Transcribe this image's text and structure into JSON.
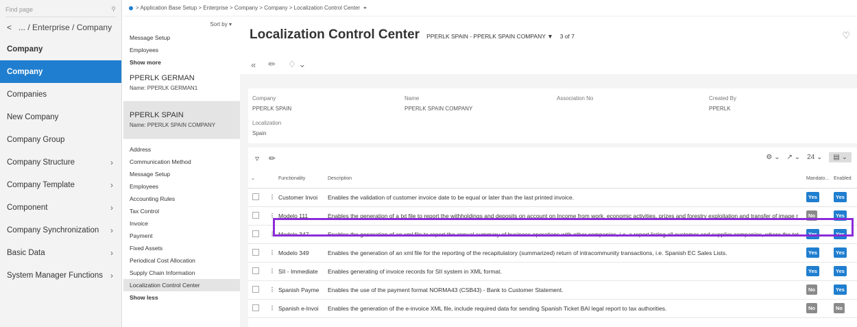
{
  "nav": {
    "search_placeholder": "Find page",
    "back_label": "... / Enterprise / Company",
    "items": [
      {
        "label": "Company",
        "style": "bold",
        "chevron": false
      },
      {
        "label": "Company",
        "style": "active",
        "chevron": false
      },
      {
        "label": "Companies",
        "style": "",
        "chevron": false
      },
      {
        "label": "New Company",
        "style": "",
        "chevron": false
      },
      {
        "label": "Company Group",
        "style": "",
        "chevron": false
      },
      {
        "label": "Company Structure",
        "style": "",
        "chevron": true
      },
      {
        "label": "Company Template",
        "style": "",
        "chevron": true
      },
      {
        "label": "Component",
        "style": "",
        "chevron": true
      },
      {
        "label": "Company Synchronization",
        "style": "",
        "chevron": true
      },
      {
        "label": "Basic Data",
        "style": "",
        "chevron": true
      },
      {
        "label": "System Manager Functions",
        "style": "",
        "chevron": true
      }
    ]
  },
  "breadcrumb": "> Application Base Setup > Enterprise > Company > Company > Localization Control Center",
  "middle": {
    "sort_label": "Sort by",
    "top_links": [
      "Message Setup",
      "Employees"
    ],
    "show_more": "Show more",
    "cards": [
      {
        "title": "PPERLK GERMAN",
        "name": "Name:  PPERLK GERMAN1"
      },
      {
        "title": "PPERLK SPAIN",
        "name": "Name:  PPERLK SPAIN COMPANY"
      }
    ],
    "links": [
      "Address",
      "Communication Method",
      "Message Setup",
      "Employees",
      "Accounting Rules",
      "Tax Control",
      "Invoice",
      "Payment",
      "Fixed Assets",
      "Periodical Cost Allocation",
      "Supply Chain Information",
      "Localization Control Center"
    ],
    "show_less": "Show less"
  },
  "header": {
    "title": "Localization Control Center",
    "subtitle": "PPERLK SPAIN - PPERLK SPAIN COMPANY",
    "record_count": "3 of 7"
  },
  "details": {
    "company_label": "Company",
    "company_value": "PPERLK SPAIN",
    "name_label": "Name",
    "name_value": "PPERLK SPAIN COMPANY",
    "assoc_label": "Association No",
    "assoc_value": "",
    "created_label": "Created By",
    "created_value": "PPERLK",
    "loc_label": "Localization",
    "loc_value": "Spain"
  },
  "grid": {
    "page_size": "24",
    "columns": [
      "Functionality",
      "Description",
      "Mandato...",
      "Enabled"
    ],
    "rows": [
      {
        "func": "Customer Invoi",
        "desc": "Enables the validation of customer invoice date to be equal or later than the last printed invoice.",
        "mand": "Yes",
        "enabled": "Yes"
      },
      {
        "func": "Modelo 111",
        "desc": "Enables the generation of a txt file to report the withholdings and deposits on account on Income from work, economic activities, prizes and forestry exploitation and transfer of image r",
        "mand": "No",
        "enabled": "Yes"
      },
      {
        "func": "Modelo 347",
        "desc": "Enables the generation of an xml file to report the annual summary of business operations with other companies, i.e. a report listing all customer and supplier companies, where the tot",
        "mand": "Yes",
        "enabled": "Yes"
      },
      {
        "func": "Modelo 349",
        "desc": "Enables the generation of an xml file for the reporting of the recapitulatory (summarized) return of intracommunity transactions, i.e. Spanish EC Sales Lists.",
        "mand": "Yes",
        "enabled": "Yes"
      },
      {
        "func": "SII - Immediate",
        "desc": "Enables generating of invoice records for SII system in XML format.",
        "mand": "Yes",
        "enabled": "Yes"
      },
      {
        "func": "Spanish Payme",
        "desc": "Enables the use of the payment format NORMA43 (CSB43) - Bank to Customer Statement.",
        "mand": "No",
        "enabled": "Yes"
      },
      {
        "func": "Spanish e-Invoi",
        "desc": "Enables the generation of the e-invoice XML file, include required data for sending Spanish Ticket BAI legal report to tax authorities.",
        "mand": "No",
        "enabled": "No"
      }
    ]
  },
  "colors": {
    "accent": "#1f7ecf",
    "highlight": "#8a2bd8",
    "no_badge": "#8a8a8a"
  }
}
